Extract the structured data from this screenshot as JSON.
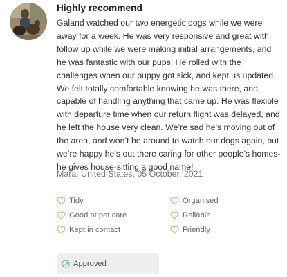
{
  "review": {
    "title": "Highly recommend",
    "body": "Galand watched our two energetic dogs while we were away for a week. He was very responsive and great with follow up while we were making initial arrangements, and he was fantastic with our pups. He rolled with the challenges when our puppy got sick, and kept us updated. We felt totally comfortable knowing he was there, and capable of handling anything that came up. He was flexible with departure time when our return flight was delayed, and he left the house very clean. We’re sad he’s moving out of the area, and won’t be around to watch our dogs again, but we’re happy he’s out there caring for other people’s homes- he gives house-sitting a good name!",
    "author_line": "Mara, United States, 05 October, 2021"
  },
  "tags": [
    {
      "label": "Tidy",
      "icon": "heart-outline-icon"
    },
    {
      "label": "Organised",
      "icon": "heart-outline-icon"
    },
    {
      "label": "Good at pet care",
      "icon": "heart-outline-icon"
    },
    {
      "label": "Reliable",
      "icon": "heart-outline-icon"
    },
    {
      "label": "Kept in contact",
      "icon": "heart-outline-icon"
    },
    {
      "label": "Friendly",
      "icon": "heart-outline-icon"
    }
  ],
  "status": {
    "label": "Approved",
    "icon": "check-circle-icon"
  },
  "colors": {
    "heart": "#e8a56c",
    "check": "#5fae72",
    "badge_bg": "#eeeeee"
  }
}
